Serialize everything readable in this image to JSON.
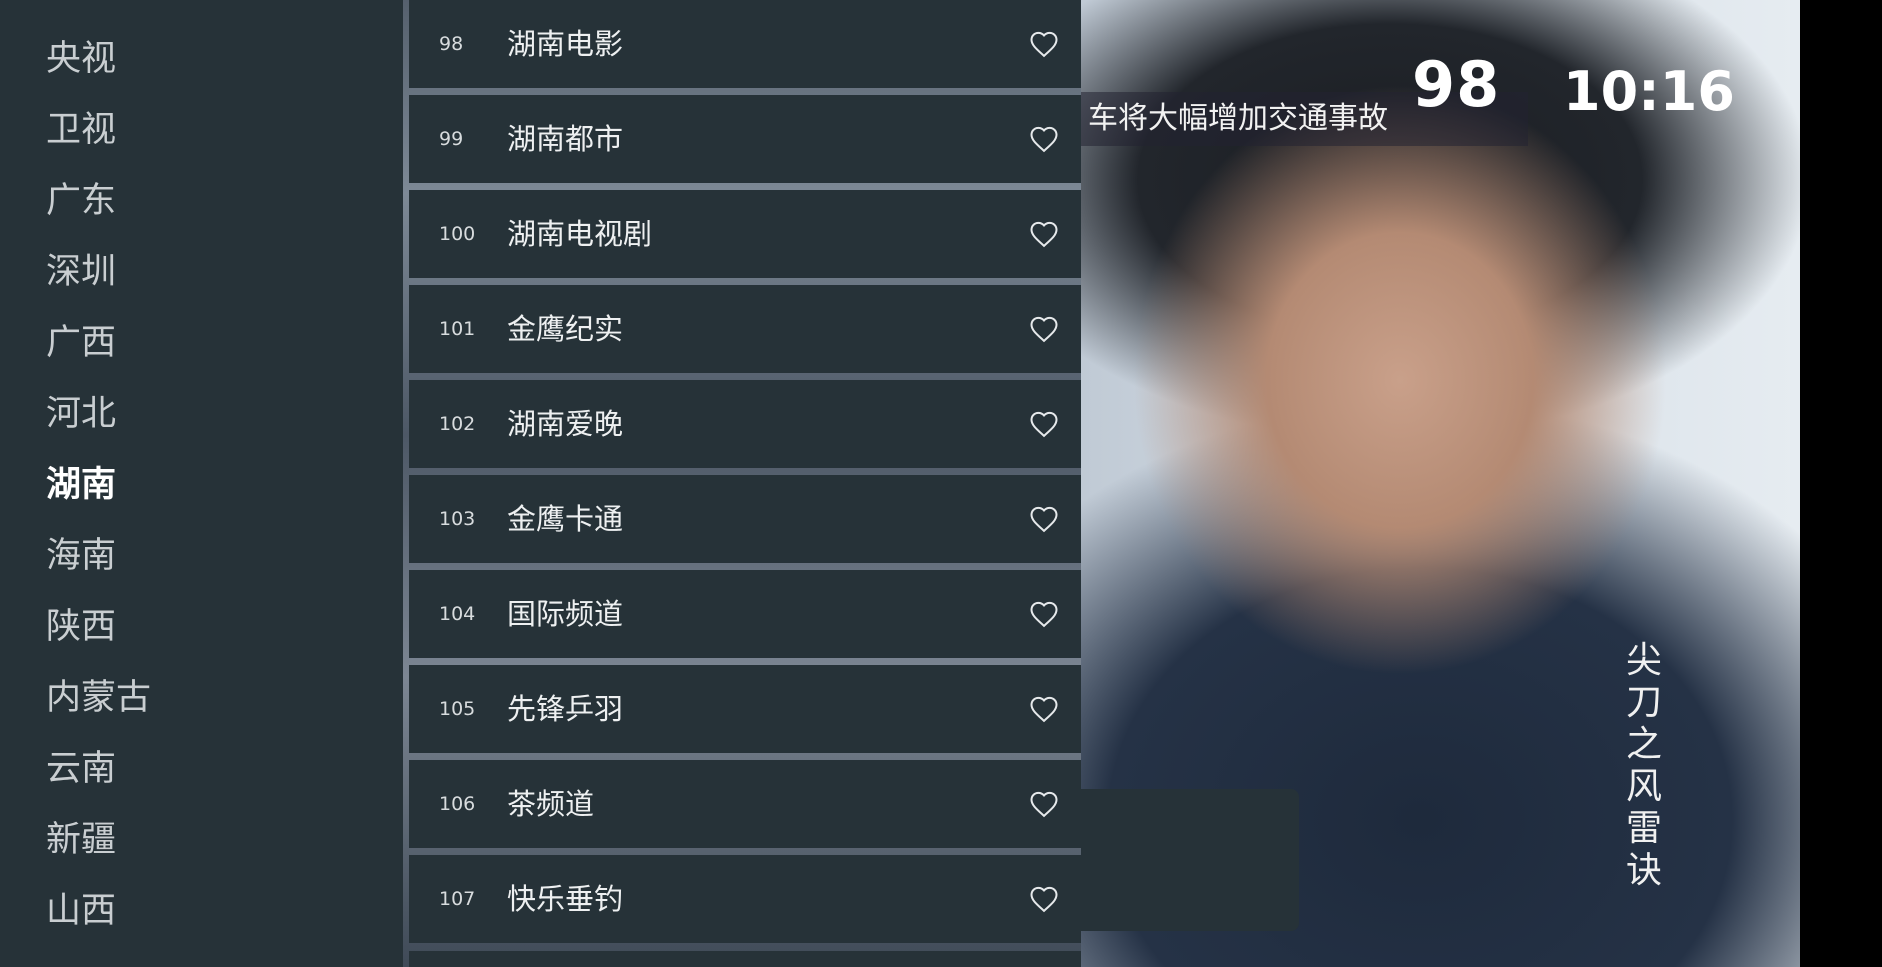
{
  "overlay": {
    "channel_number": "98",
    "clock": "10:16"
  },
  "video": {
    "ticker_text": "车将大幅增加交通事故",
    "vertical_caption": "尖刀之风雷诀"
  },
  "categories": [
    {
      "label": "央视",
      "active": false
    },
    {
      "label": "卫视",
      "active": false
    },
    {
      "label": "广东",
      "active": false
    },
    {
      "label": "深圳",
      "active": false
    },
    {
      "label": "广西",
      "active": false
    },
    {
      "label": "河北",
      "active": false
    },
    {
      "label": "湖南",
      "active": true
    },
    {
      "label": "海南",
      "active": false
    },
    {
      "label": "陕西",
      "active": false
    },
    {
      "label": "内蒙古",
      "active": false
    },
    {
      "label": "云南",
      "active": false
    },
    {
      "label": "新疆",
      "active": false
    },
    {
      "label": "山西",
      "active": false
    }
  ],
  "channels": [
    {
      "number": "98",
      "name": "湖南电影"
    },
    {
      "number": "99",
      "name": "湖南都市"
    },
    {
      "number": "100",
      "name": "湖南电视剧"
    },
    {
      "number": "101",
      "name": "金鹰纪实"
    },
    {
      "number": "102",
      "name": "湖南爱晚"
    },
    {
      "number": "103",
      "name": "金鹰卡通"
    },
    {
      "number": "104",
      "name": "国际频道"
    },
    {
      "number": "105",
      "name": "先锋乒羽"
    },
    {
      "number": "106",
      "name": "茶频道"
    },
    {
      "number": "107",
      "name": "快乐垂钓"
    }
  ],
  "icons": {
    "favorite": "heart-outline-icon"
  },
  "colors": {
    "panel_bg": "#263238",
    "text_primary": "#ffffff",
    "text_secondary": "#c9ced1"
  }
}
